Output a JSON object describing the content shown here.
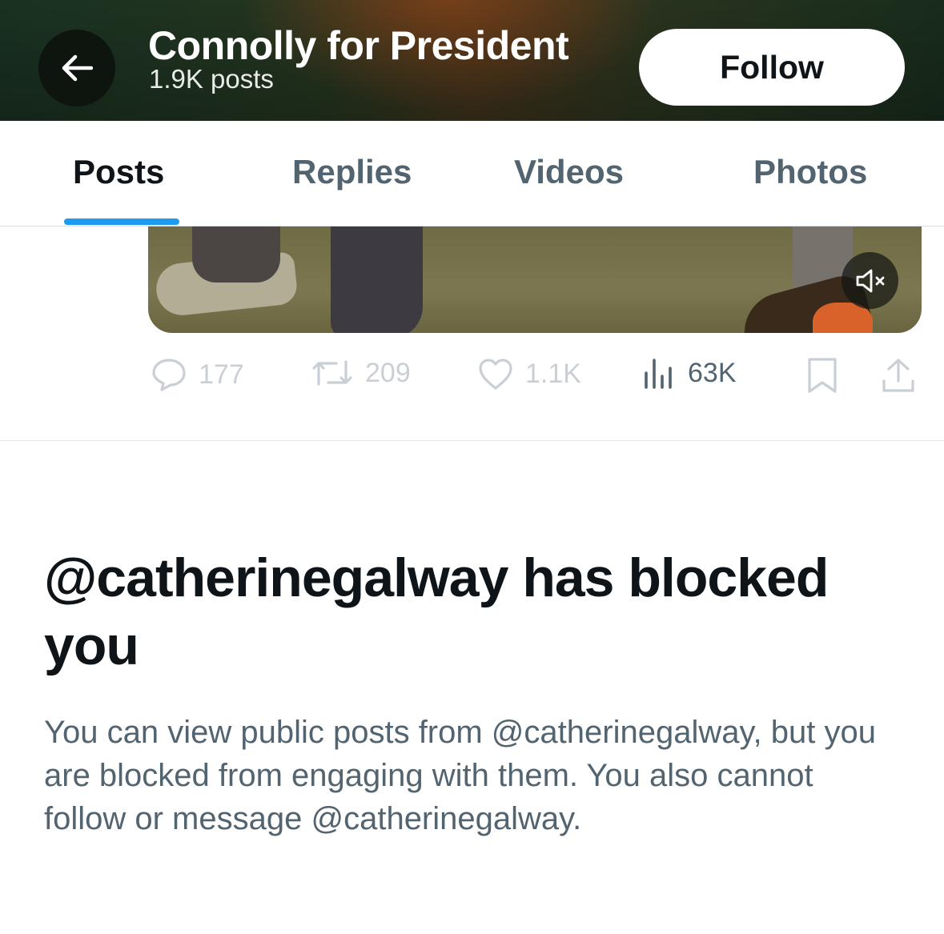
{
  "header": {
    "title": "Connolly for President",
    "post_count": "1.9K posts",
    "follow_label": "Follow",
    "back_icon": "arrow-left-icon"
  },
  "tabs": [
    {
      "label": "Posts",
      "active": true
    },
    {
      "label": "Replies",
      "active": false
    },
    {
      "label": "Videos",
      "active": false
    },
    {
      "label": "Photos",
      "active": false
    }
  ],
  "post": {
    "media_icon": "volume-muted-icon",
    "actions": {
      "replies": "177",
      "reposts": "209",
      "likes": "1.1K",
      "views": "63K"
    }
  },
  "blocked": {
    "title": "@catherinegalway has blocked you",
    "description": "You can view public posts from @catherinegalway, but you are blocked from engaging with them. You also cannot follow or message @catherinegalway."
  },
  "colors": {
    "accent": "#1d9bf0",
    "text_primary": "#0f1419",
    "text_secondary": "#536471"
  }
}
